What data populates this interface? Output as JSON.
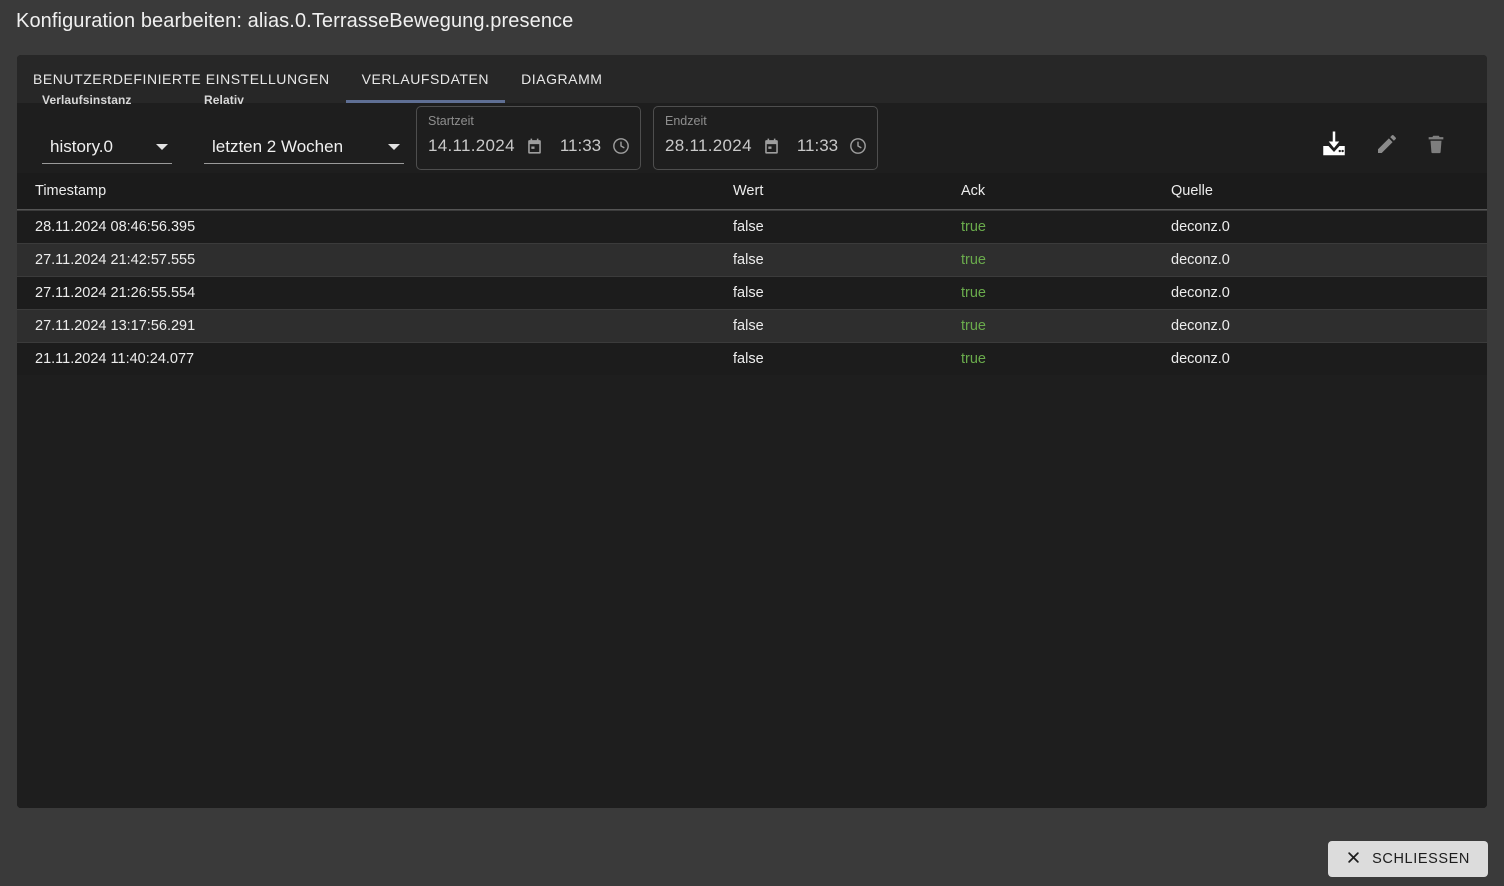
{
  "dialog": {
    "title": "Konfiguration bearbeiten: alias.0.TerrasseBewegung.presence"
  },
  "tabs": [
    {
      "label": "BENUTZERDEFINIERTE EINSTELLUNGEN",
      "active": false
    },
    {
      "label": "VERLAUFSDATEN",
      "active": true
    },
    {
      "label": "DIAGRAMM",
      "active": false
    }
  ],
  "toolbar": {
    "history_instance": {
      "label": "Verlaufsinstanz",
      "value": "history.0"
    },
    "relative": {
      "label": "Relativ",
      "value": "letzten 2 Wochen"
    },
    "start": {
      "label": "Startzeit",
      "date": "14.11.2024",
      "time": "11:33"
    },
    "end": {
      "label": "Endzeit",
      "date": "28.11.2024",
      "time": "11:33"
    },
    "actions": [
      {
        "name": "download-icon",
        "title": "Download"
      },
      {
        "name": "edit-icon",
        "title": "Bearbeiten"
      },
      {
        "name": "delete-icon",
        "title": "Löschen"
      }
    ]
  },
  "table": {
    "columns": [
      "Timestamp",
      "Wert",
      "Ack",
      "Quelle"
    ],
    "rows": [
      {
        "timestamp": "28.11.2024 08:46:56.395",
        "wert": "false",
        "ack": "true",
        "quelle": "deconz.0"
      },
      {
        "timestamp": "27.11.2024 21:42:57.555",
        "wert": "false",
        "ack": "true",
        "quelle": "deconz.0"
      },
      {
        "timestamp": "27.11.2024 21:26:55.554",
        "wert": "false",
        "ack": "true",
        "quelle": "deconz.0"
      },
      {
        "timestamp": "27.11.2024 13:17:56.291",
        "wert": "false",
        "ack": "true",
        "quelle": "deconz.0"
      },
      {
        "timestamp": "21.11.2024 11:40:24.077",
        "wert": "false",
        "ack": "true",
        "quelle": "deconz.0"
      }
    ]
  },
  "footer": {
    "close_label": "SCHLIESSEN",
    "close_icon": "close-icon"
  },
  "colors": {
    "accent_underline": "#5f6f94",
    "ack_true": "#6aab4c",
    "panel_bg": "#1e1e1e",
    "tabbar_bg": "#272727",
    "page_bg": "#3a3a3a",
    "row_odd": "#1c1c1c",
    "row_even": "#2e2e2e",
    "close_btn_bg": "#dcdcdc"
  }
}
